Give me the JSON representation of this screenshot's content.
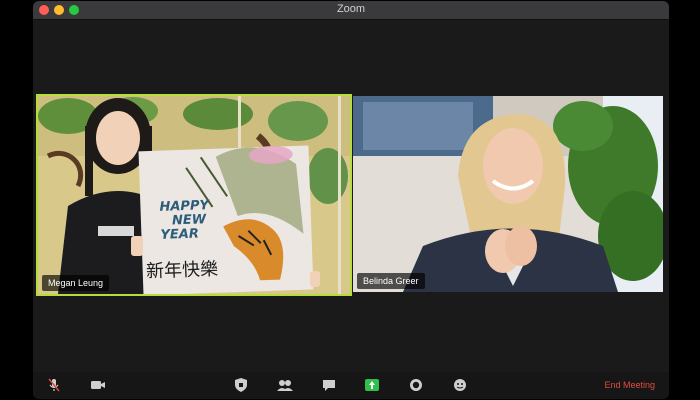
{
  "window": {
    "title": "Zoom"
  },
  "participants": [
    {
      "name": "Megan Leung",
      "active_speaker": true,
      "sign_lines": [
        "HAPPY",
        "NEW",
        "YEAR"
      ],
      "sign_chinese": "新年快樂"
    },
    {
      "name": "Belinda Greer",
      "active_speaker": false
    }
  ],
  "toolbar": {
    "icons": [
      "microphone-muted-icon",
      "video-icon",
      "security-icon",
      "participants-icon",
      "chat-icon",
      "share-screen-icon",
      "record-icon",
      "reactions-icon"
    ],
    "end_label": "End Meeting"
  },
  "colors": {
    "active_border": "#b6dd3b",
    "end_meeting": "#e24c3d",
    "share_green": "#2fbf4a"
  }
}
